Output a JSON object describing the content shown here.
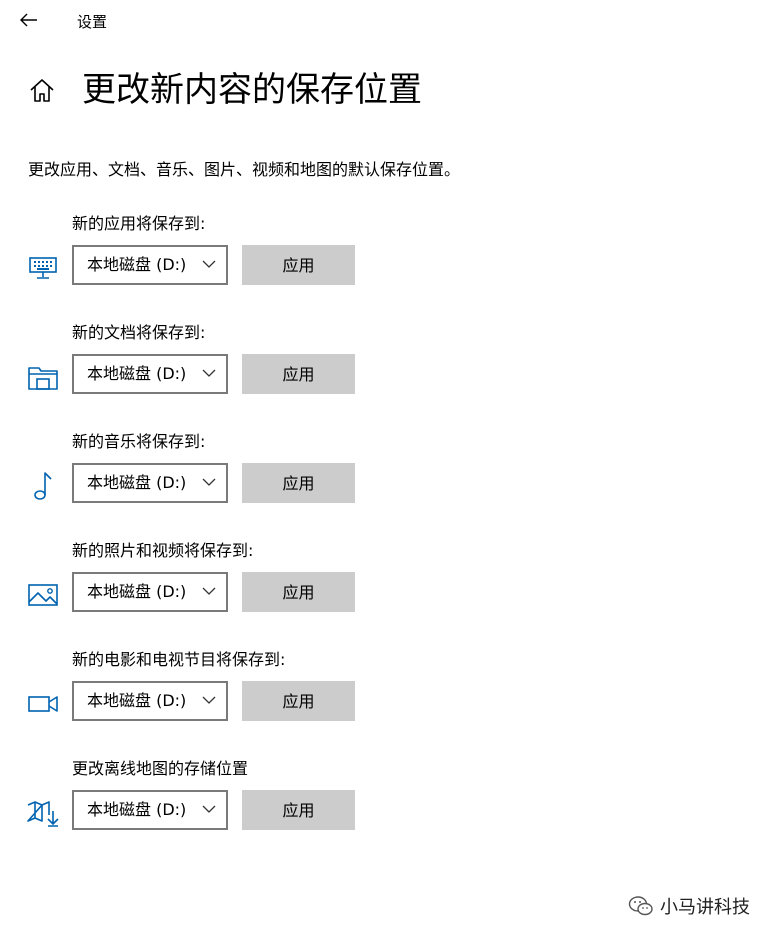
{
  "window": {
    "title": "设置",
    "back_label": "back"
  },
  "page": {
    "title": "更改新内容的保存位置",
    "description": "更改应用、文档、音乐、图片、视频和地图的默认保存位置。"
  },
  "settings": [
    {
      "label": "新的应用将保存到:",
      "icon": "monitor-keyboard-icon",
      "value": "本地磁盘 (D:)",
      "apply": "应用"
    },
    {
      "label": "新的文档将保存到:",
      "icon": "documents-folder-icon",
      "value": "本地磁盘 (D:)",
      "apply": "应用"
    },
    {
      "label": "新的音乐将保存到:",
      "icon": "music-note-icon",
      "value": "本地磁盘 (D:)",
      "apply": "应用"
    },
    {
      "label": "新的照片和视频将保存到:",
      "icon": "pictures-icon",
      "value": "本地磁盘 (D:)",
      "apply": "应用"
    },
    {
      "label": "新的电影和电视节目将保存到:",
      "icon": "video-camera-icon",
      "value": "本地磁盘 (D:)",
      "apply": "应用"
    },
    {
      "label": "更改离线地图的存储位置",
      "icon": "offline-map-icon",
      "value": "本地磁盘 (D:)",
      "apply": "应用"
    }
  ],
  "watermark": {
    "text": "小马讲科技",
    "icon": "wechat-icon"
  },
  "colors": {
    "accent": "#0063b1",
    "button_bg": "#cccccc",
    "border": "#7a7a7a"
  }
}
